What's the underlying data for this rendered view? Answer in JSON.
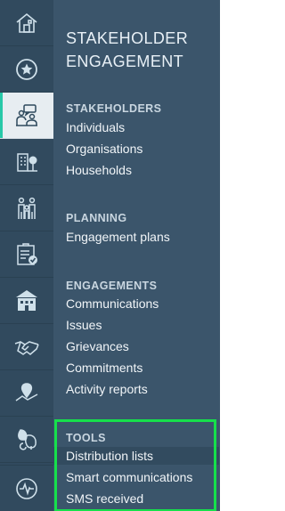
{
  "rail": {
    "items": [
      {
        "name": "home-icon",
        "active": false
      },
      {
        "name": "star-icon",
        "active": false
      },
      {
        "name": "stakeholder-meeting-icon",
        "active": true
      },
      {
        "name": "buildings-icon",
        "active": false
      },
      {
        "name": "people-icon",
        "active": false
      },
      {
        "name": "checklist-icon",
        "active": false
      },
      {
        "name": "institution-icon",
        "active": false
      },
      {
        "name": "handshake-icon",
        "active": false
      },
      {
        "name": "location-map-icon",
        "active": false
      },
      {
        "name": "environment-icon",
        "active": false
      }
    ],
    "bottom_item": "activity-icon"
  },
  "panel": {
    "title_line1": "STAKEHOLDER",
    "title_line2": "ENGAGEMENT",
    "sections": {
      "stakeholders": {
        "header": "STAKEHOLDERS",
        "items": [
          "Individuals",
          "Organisations",
          "Households"
        ]
      },
      "planning": {
        "header": "PLANNING",
        "items": [
          "Engagement plans"
        ]
      },
      "engagements": {
        "header": "ENGAGEMENTS",
        "items": [
          "Communications",
          "Issues",
          "Grievances",
          "Commitments",
          "Activity reports"
        ]
      },
      "tools": {
        "header": "TOOLS",
        "items": [
          "Distribution lists",
          "Smart communications",
          "SMS received"
        ]
      }
    }
  },
  "colors": {
    "rail_bg": "#314a5e",
    "panel_bg": "#3b556b",
    "active_accent": "#27c8a8",
    "highlight_frame": "#16e04b"
  }
}
